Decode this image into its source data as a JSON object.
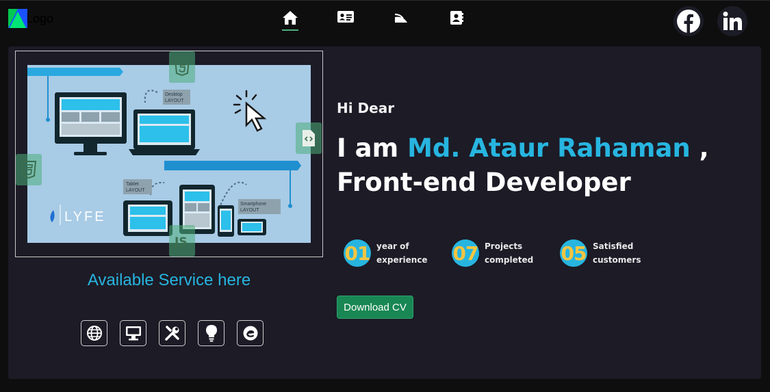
{
  "nav": {
    "logo_text": "Logo",
    "items": [
      "home-icon",
      "profile-card-icon",
      "rss-icon",
      "contacts-icon"
    ],
    "active_item": "home-icon",
    "social": [
      "facebook-icon",
      "linkedin-icon"
    ]
  },
  "hero": {
    "image_text": {
      "desktop": "Desktop\nLAYOUT",
      "tablet": "Tablet\nLAYOUT",
      "smartphone": "Smartphone\nLAYOUT",
      "brand": "LYFE"
    },
    "floating_icons": [
      "html5-icon",
      "css3-icon",
      "code-file-icon",
      "js-icon"
    ],
    "service_title": "Available Service here",
    "service_icons": [
      "globe-icon",
      "monitor-icon",
      "tools-icon",
      "lightbulb-icon",
      "wordpress-elementor-icon"
    ],
    "greeting": "Hi Dear",
    "headline_prefix": "I am",
    "name": "Md. Ataur Rahaman",
    "headline_suffix": ", Front-end Developer",
    "stats": [
      {
        "number": "01",
        "line1": "year of",
        "line2": "experience"
      },
      {
        "number": "07",
        "line1": "Projects",
        "line2": "completed"
      },
      {
        "number": "05",
        "line1": "Satisfied",
        "line2": "customers"
      }
    ],
    "download_label": "Download CV"
  },
  "colors": {
    "accent": "#27b5e0",
    "stat_number": "#f4c542",
    "button": "#198754",
    "panel": "#1c1b26",
    "background": "#0e0e0f"
  }
}
